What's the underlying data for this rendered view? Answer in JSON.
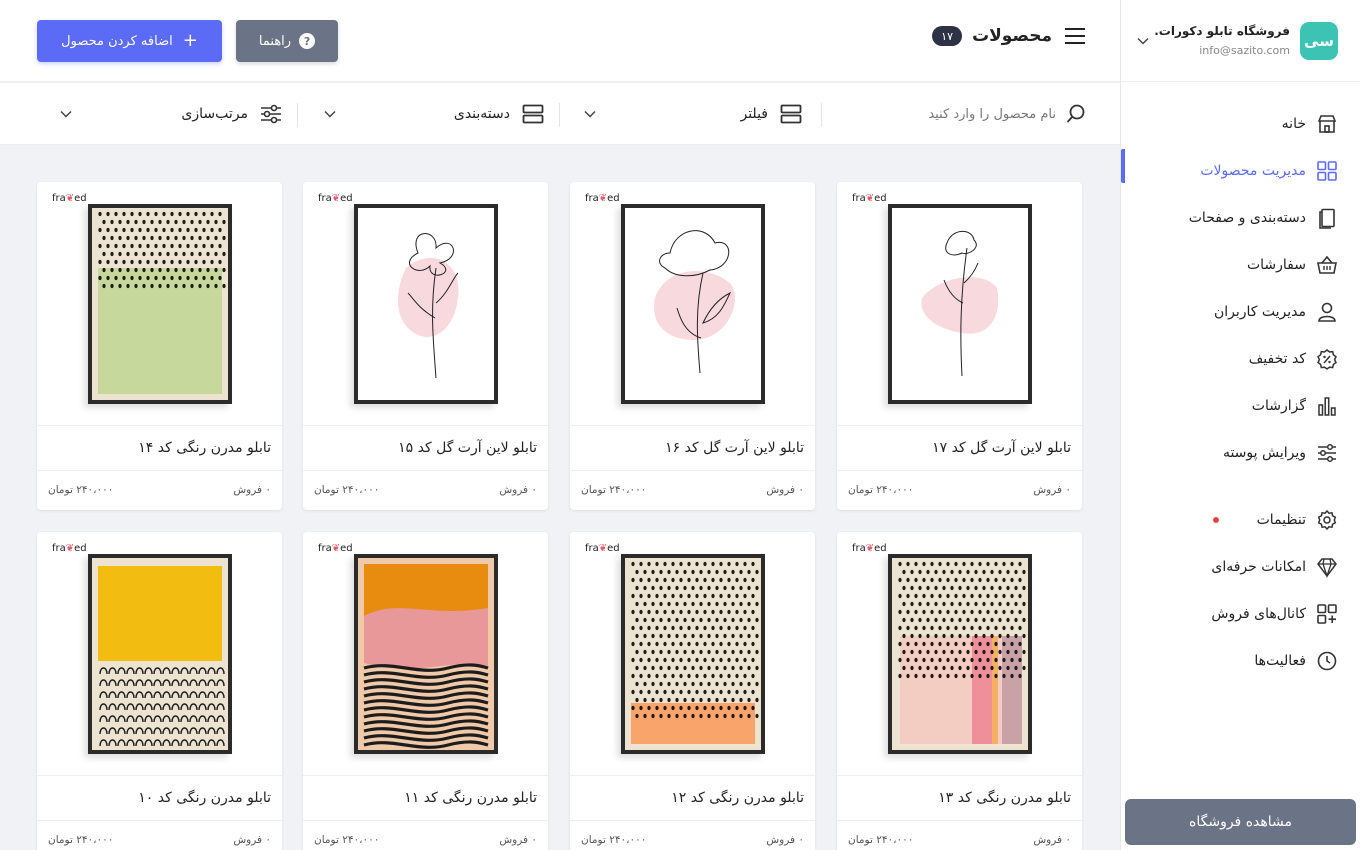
{
  "store": {
    "name": "فروشگاه تابلو دکورات...",
    "email": "info@sazito.com",
    "logo_text": "سی"
  },
  "nav": [
    {
      "label": "خانه",
      "icon": "store-icon"
    },
    {
      "label": "مدیریت محصولات",
      "icon": "grid-icon",
      "active": true
    },
    {
      "label": "دسته‌بندی و صفحات",
      "icon": "pages-icon"
    },
    {
      "label": "سفارشات",
      "icon": "basket-icon"
    },
    {
      "label": "مدیریت کاربران",
      "icon": "user-icon"
    },
    {
      "label": "کد تخفیف",
      "icon": "discount-icon"
    },
    {
      "label": "گزارشات",
      "icon": "chart-icon"
    },
    {
      "label": "ویرایش پوسته",
      "icon": "sliders-icon"
    },
    {
      "label": "تنظیمات",
      "icon": "gear-icon"
    },
    {
      "label": "امکانات حرفه‌ای",
      "icon": "diamond-icon"
    },
    {
      "label": "کانال‌های فروش",
      "icon": "channels-icon"
    },
    {
      "label": "فعالیت‌ها",
      "icon": "clock-icon"
    }
  ],
  "view_store_label": "مشاهده فروشگاه",
  "header": {
    "title": "محصولات",
    "count": "۱۷",
    "guide_label": "راهنما",
    "add_label": "اضافه کردن محصول"
  },
  "filters": {
    "search_placeholder": "نام محصول را وارد کنید",
    "filter_label": "فیلتر",
    "category_label": "دسته‌بندی",
    "sort_label": "مرتب‌سازی"
  },
  "brand": {
    "pre": "fra",
    "mid": "❦",
    "post": "ed"
  },
  "products": [
    {
      "name": "تابلو لاین آرت گل کد ۱۷",
      "sales": "۰ فروش",
      "price": "۲۴۰،۰۰۰ تومان",
      "art": "line3"
    },
    {
      "name": "تابلو لاین آرت گل کد ۱۶",
      "sales": "۰ فروش",
      "price": "۲۴۰،۰۰۰ تومان",
      "art": "line2"
    },
    {
      "name": "تابلو لاین آرت گل کد ۱۵",
      "sales": "۰ فروش",
      "price": "۲۴۰،۰۰۰ تومان",
      "art": "line1"
    },
    {
      "name": "تابلو مدرن رنگی کد ۱۴",
      "sales": "۰ فروش",
      "price": "۲۴۰،۰۰۰ تومان",
      "art": "green"
    },
    {
      "name": "تابلو مدرن رنگی کد ۱۳",
      "sales": "۰ فروش",
      "price": "۲۴۰،۰۰۰ تومان",
      "art": "pinkbars"
    },
    {
      "name": "تابلو مدرن رنگی کد ۱۲",
      "sales": "۰ فروش",
      "price": "۲۴۰،۰۰۰ تومان",
      "art": "orange"
    },
    {
      "name": "تابلو مدرن رنگی کد ۱۱",
      "sales": "۰ فروش",
      "price": "۲۴۰،۰۰۰ تومان",
      "art": "waves"
    },
    {
      "name": "تابلو مدرن رنگی کد ۱۰",
      "sales": "۰ فروش",
      "price": "۲۴۰،۰۰۰ تومان",
      "art": "yellow"
    }
  ],
  "colors": {
    "accent": "#5b6bf5",
    "gray_button": "#6b7486",
    "badge": "#2d3345",
    "notify_dot": "#ef4444",
    "logo": "#3cc3b3"
  }
}
